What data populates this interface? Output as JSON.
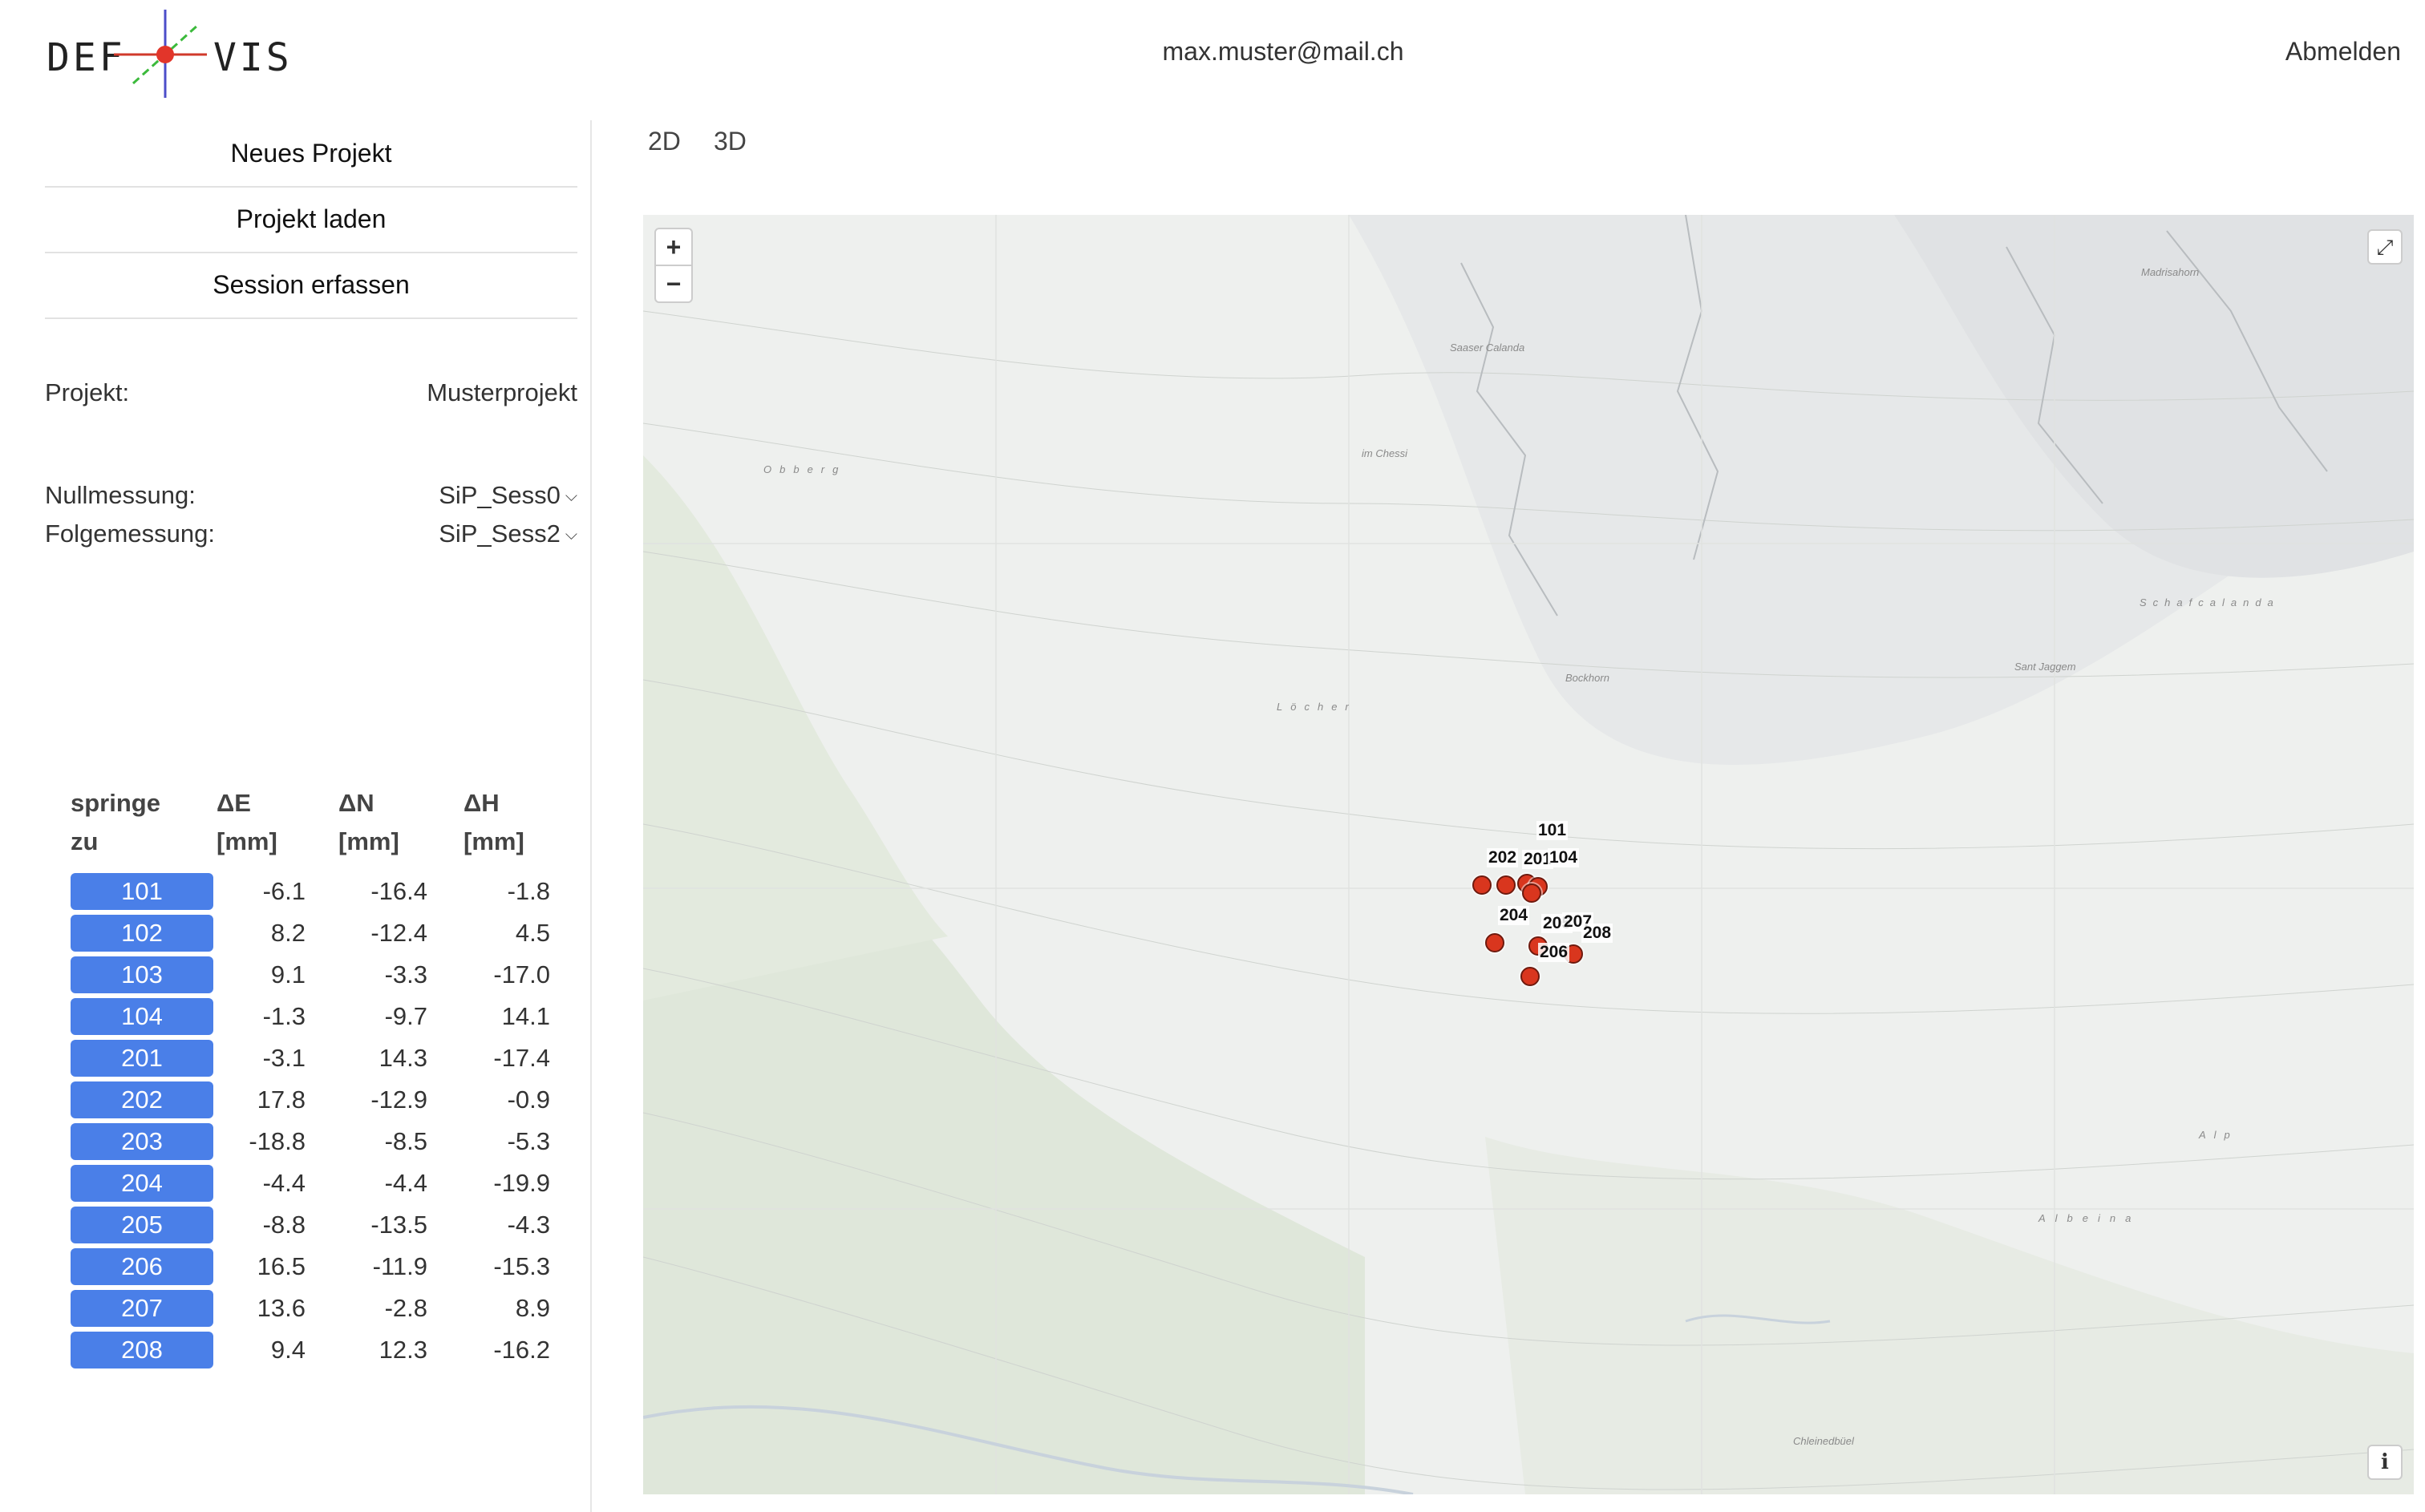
{
  "header": {
    "logo_left": "DEF",
    "logo_right": "VIS",
    "user_email": "max.muster@mail.ch",
    "logout_label": "Abmelden"
  },
  "sidebar": {
    "menu": [
      "Neues Projekt",
      "Projekt laden",
      "Session erfassen"
    ],
    "project_label": "Projekt:",
    "project_value": "Musterprojekt",
    "zero_label": "Nullmessung:",
    "zero_value": "SiP_Sess0",
    "follow_label": "Folgemessung:",
    "follow_value": "SiP_Sess2"
  },
  "table": {
    "headers": [
      {
        "l1": "springe",
        "l2": "zu"
      },
      {
        "l1": "ΔE",
        "l2": "[mm]"
      },
      {
        "l1": "ΔN",
        "l2": "[mm]"
      },
      {
        "l1": "ΔH",
        "l2": "[mm]"
      }
    ],
    "rows": [
      {
        "pt": "101",
        "de": "-6.1",
        "dn": "-16.4",
        "dh": "-1.8"
      },
      {
        "pt": "102",
        "de": "8.2",
        "dn": "-12.4",
        "dh": "4.5"
      },
      {
        "pt": "103",
        "de": "9.1",
        "dn": "-3.3",
        "dh": "-17.0"
      },
      {
        "pt": "104",
        "de": "-1.3",
        "dn": "-9.7",
        "dh": "14.1"
      },
      {
        "pt": "201",
        "de": "-3.1",
        "dn": "14.3",
        "dh": "-17.4"
      },
      {
        "pt": "202",
        "de": "17.8",
        "dn": "-12.9",
        "dh": "-0.9"
      },
      {
        "pt": "203",
        "de": "-18.8",
        "dn": "-8.5",
        "dh": "-5.3"
      },
      {
        "pt": "204",
        "de": "-4.4",
        "dn": "-4.4",
        "dh": "-19.9"
      },
      {
        "pt": "205",
        "de": "-8.8",
        "dn": "-13.5",
        "dh": "-4.3"
      },
      {
        "pt": "206",
        "de": "16.5",
        "dn": "-11.9",
        "dh": "-15.3"
      },
      {
        "pt": "207",
        "de": "13.6",
        "dn": "-2.8",
        "dh": "8.9"
      },
      {
        "pt": "208",
        "de": "9.4",
        "dn": "12.3",
        "dh": "-16.2"
      }
    ]
  },
  "tabs": [
    "2D",
    "3D"
  ],
  "map": {
    "zoom_in": "+",
    "zoom_out": "−",
    "fullscreen_icon": "⤢",
    "attribution_icon": "i",
    "place_names": [
      "Saaser Calanda",
      "Madrisahorn",
      "Schafcalanda",
      "Sant Jaggem",
      "Löcher",
      "Bockhorn",
      "Albeina",
      "Chleinedbüel",
      "Alp",
      "Obberg",
      "im Chessi"
    ],
    "point_labels": [
      "101",
      "202",
      "201",
      "104",
      "204",
      "205",
      "207",
      "206",
      "208"
    ],
    "marker_color": "#d9361e"
  }
}
